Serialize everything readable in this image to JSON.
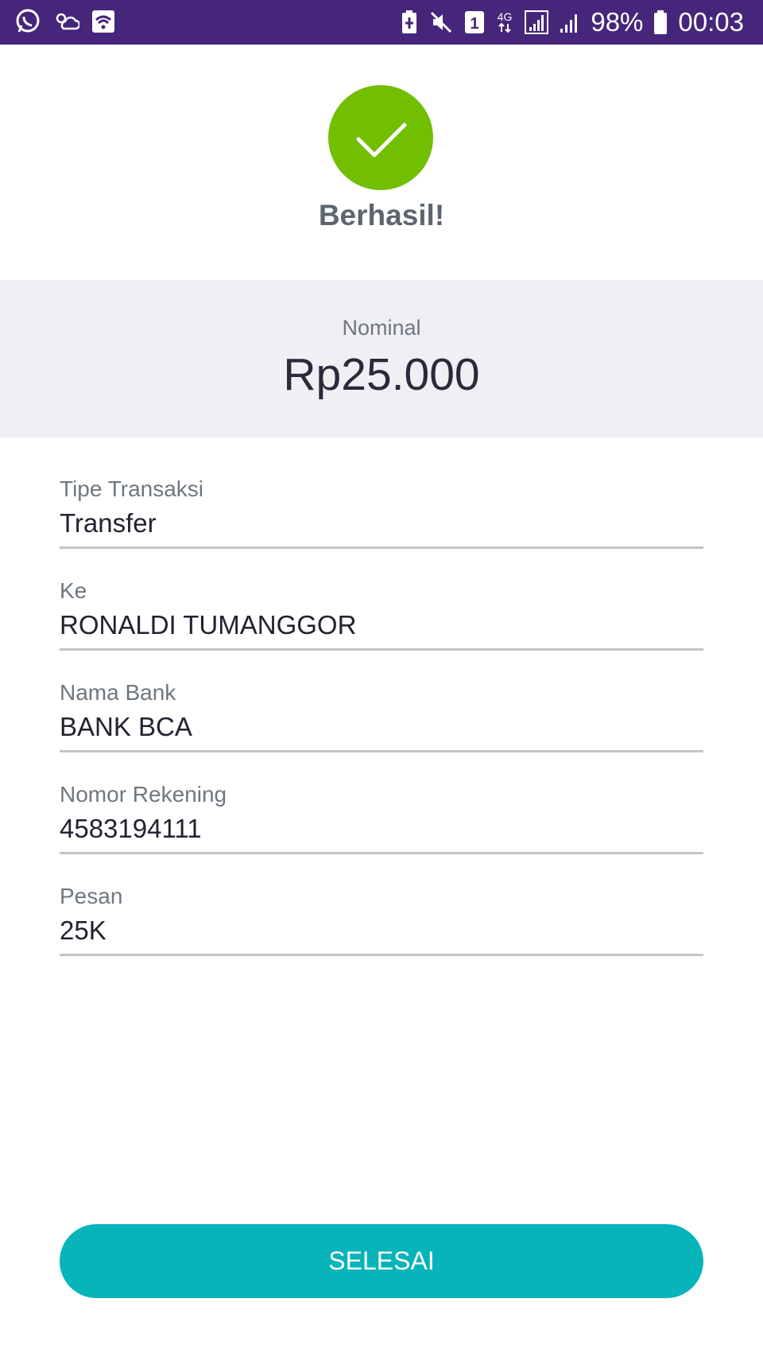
{
  "status_bar": {
    "left_icons": [
      "whatsapp-icon",
      "weather-icon",
      "wifi-icon"
    ],
    "right_icons": [
      "battery-saver-icon",
      "mute-icon",
      "sim-1-icon",
      "network-4g-icon",
      "signal-icon",
      "signal-2-icon",
      "battery-icon"
    ],
    "network_type": "4G",
    "sim_slot": "1",
    "battery": "98%",
    "time": "00:03",
    "bg_color": "#46267a"
  },
  "success": {
    "icon": "check-icon",
    "title": "Berhasil!",
    "color": "#72be00"
  },
  "nominal": {
    "label": "Nominal",
    "value": "Rp25.000"
  },
  "fields": [
    {
      "label": "Tipe Transaksi",
      "value": "Transfer"
    },
    {
      "label": "Ke",
      "value": "RONALDI TUMANGGOR"
    },
    {
      "label": "Nama Bank",
      "value": "BANK BCA"
    },
    {
      "label": "Nomor Rekening",
      "value": "4583194111"
    },
    {
      "label": "Pesan",
      "value": "25K"
    }
  ],
  "button": {
    "label": "SELESAI",
    "color": "#06b4ba"
  }
}
